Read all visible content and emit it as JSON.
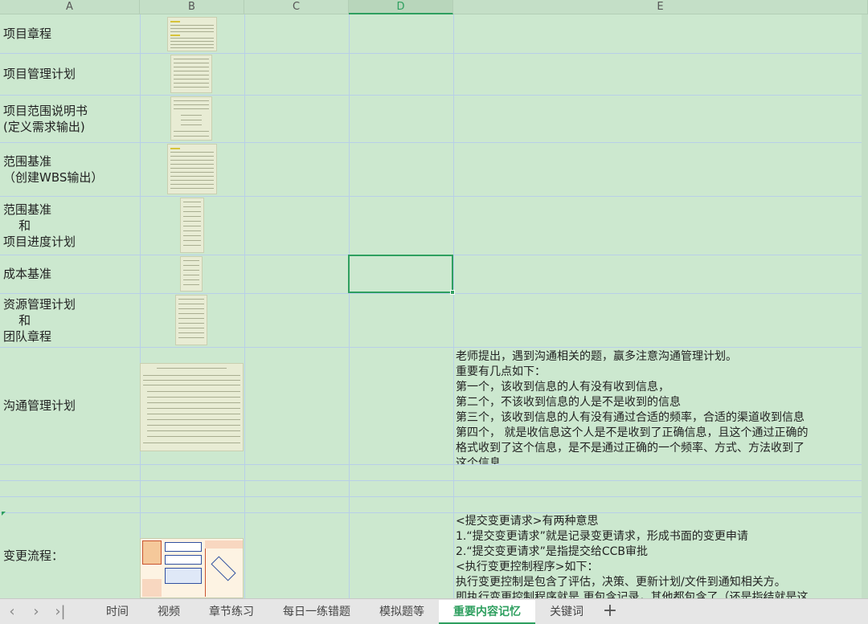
{
  "columns": [
    "A",
    "B",
    "C",
    "D",
    "E"
  ],
  "active_column": "D",
  "rows": [
    {
      "label": "项目章程"
    },
    {
      "label": "项目管理计划"
    },
    {
      "label": "项目范围说明书\n(定义需求输出)"
    },
    {
      "label": "范围基准\n（创建WBS输出）"
    },
    {
      "label": "范围基准\n    和\n项目进度计划"
    },
    {
      "label": "成本基准"
    },
    {
      "label": "资源管理计划\n    和\n团队章程"
    },
    {
      "label": "沟通管理计划"
    },
    {
      "label": "变更流程："
    }
  ],
  "notes": {
    "communication": [
      "老师提出，遇到沟通相关的题，赢多注意沟通管理计划。",
      "重要有几点如下：",
      "第一个，该收到信息的人有没有收到信息，",
      "第二个，不该收到信息的人是不是收到的信息",
      "第三个，该收到信息的人有没有通过合适的频率，合适的渠道收到信息",
      "第四个，  就是收信息这个人是不是收到了正确信息，且这个通过正确的",
      "格式收到了这个信息，是不是通过正确的一个频率、方式、方法收到了",
      "这个信息"
    ],
    "change": [
      "<提交变更请求>有两种意思",
      "1.“提交变更请求”就是记录变更请求，形成书面的变更申请",
      "2.“提交变更请求”是指提交给CCB审批",
      "<执行变更控制程序>如下：",
      "执行变更控制是包含了评估，决策、更新计划/文件到通知相关方。",
      "即执行变更控制程序就是 更包含记录，其他都包含了（还是指结就是这"
    ]
  },
  "tabs": [
    "时间",
    "视频",
    "章节练习",
    "每日一练错题",
    "模拟题等",
    "重要内容记忆",
    "关键词"
  ],
  "active_tab": "重要内容记忆",
  "nav_icons": [
    "first-sheet-icon",
    "prev-sheet-icon",
    "next-sheet-icon",
    "last-sheet-icon"
  ],
  "colors": {
    "sheet_bg": "#cce8cf",
    "accent": "#2e9f5f",
    "grid": "#b8cfe8"
  }
}
